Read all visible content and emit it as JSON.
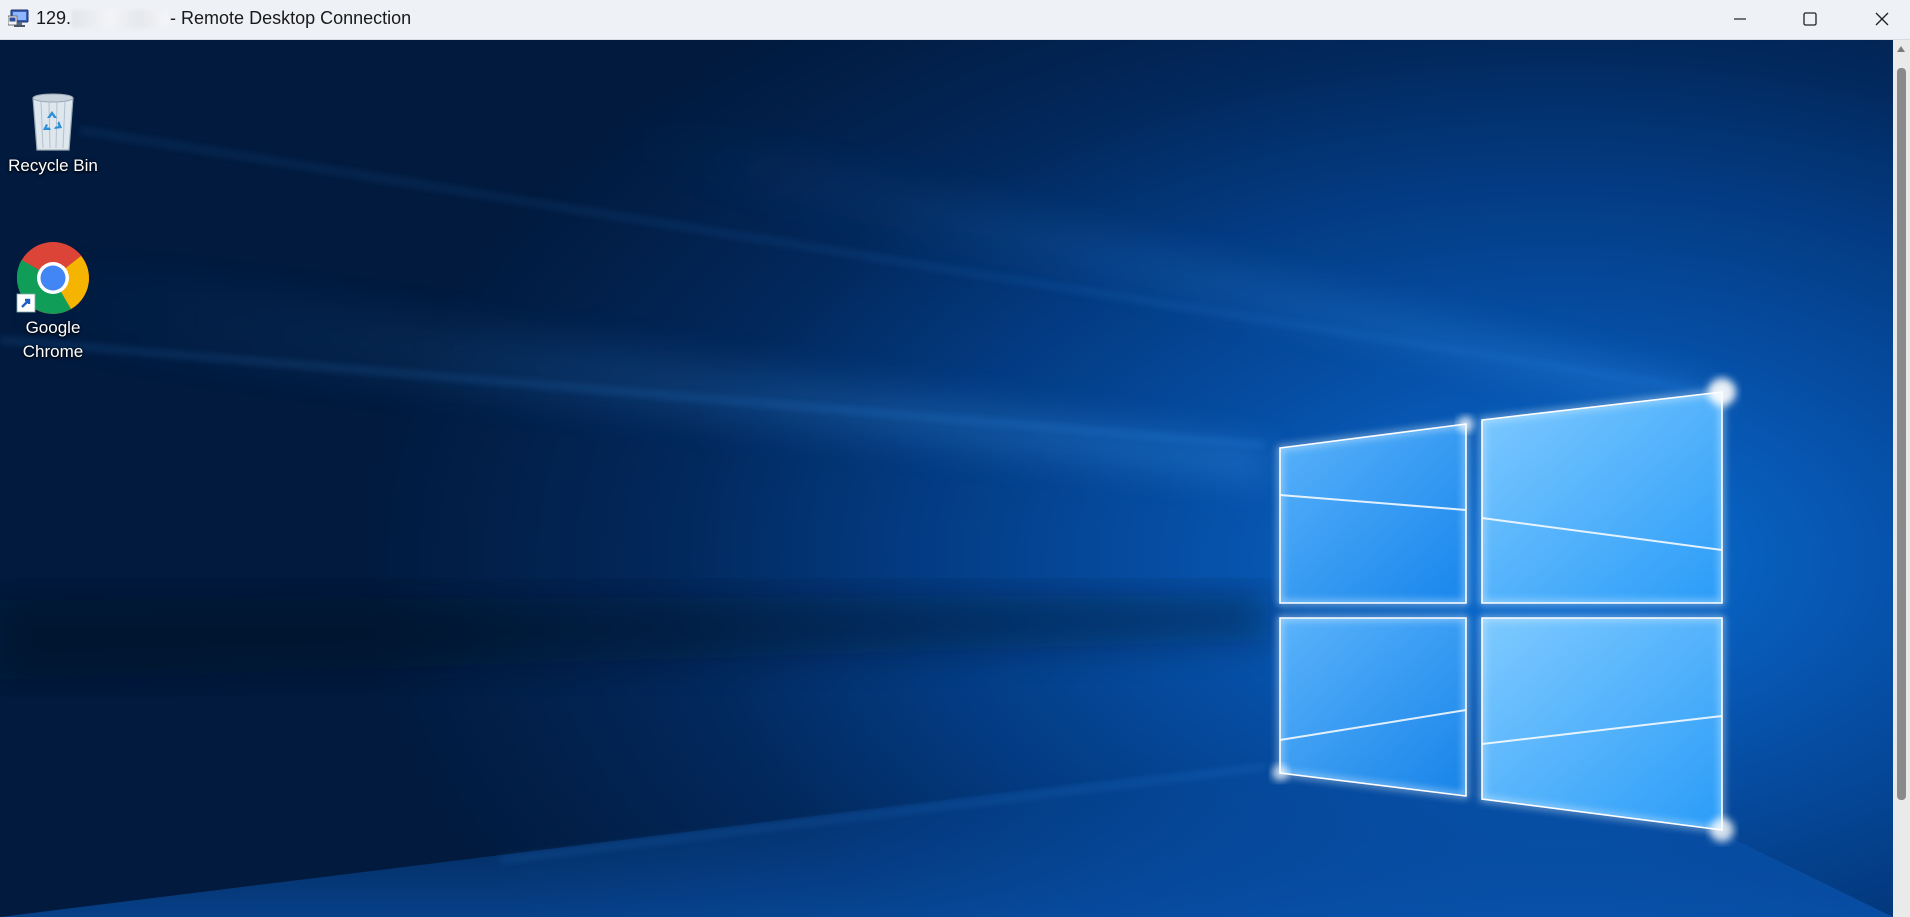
{
  "window": {
    "title_prefix": "129.",
    "title_suffix": "- Remote Desktop Connection",
    "icon": "remote-desktop-icon"
  },
  "controls": {
    "minimize_icon": "minimize-icon",
    "maximize_icon": "maximize-icon",
    "close_icon": "close-icon"
  },
  "desktop": {
    "icons": [
      {
        "label": "Recycle Bin",
        "icon": "recycle-bin-icon"
      },
      {
        "label": "Google\nChrome",
        "label_line1": "Google",
        "label_line2": "Chrome",
        "icon": "chrome-icon"
      }
    ]
  },
  "colors": {
    "accent": "#0a78e0",
    "titlebar": "#eef1f6"
  }
}
